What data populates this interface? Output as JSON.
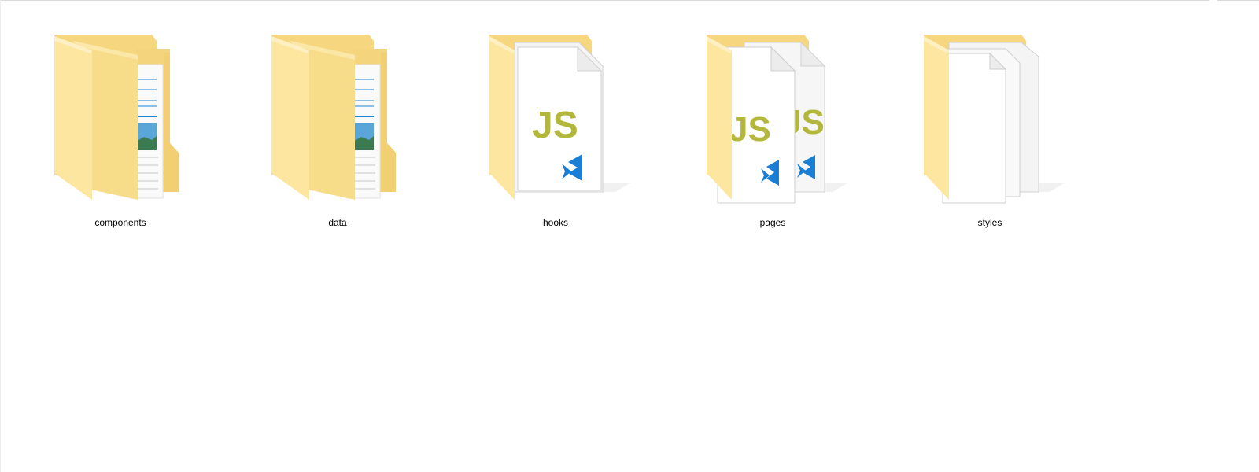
{
  "explorer": {
    "items": [
      {
        "label": "components",
        "type": "folder-documents"
      },
      {
        "label": "data",
        "type": "folder-documents"
      },
      {
        "label": "hooks",
        "type": "folder-js"
      },
      {
        "label": "pages",
        "type": "folder-js-multi"
      },
      {
        "label": "styles",
        "type": "folder-blank"
      }
    ]
  },
  "icons": {
    "js_text": "JS"
  },
  "colors": {
    "folder_light": "#fce49a",
    "folder_dark": "#f0d27a",
    "js_yellow": "#b3b83c",
    "vscode_blue": "#1a7fd4",
    "doc_blue_line": "#1a86d8"
  }
}
